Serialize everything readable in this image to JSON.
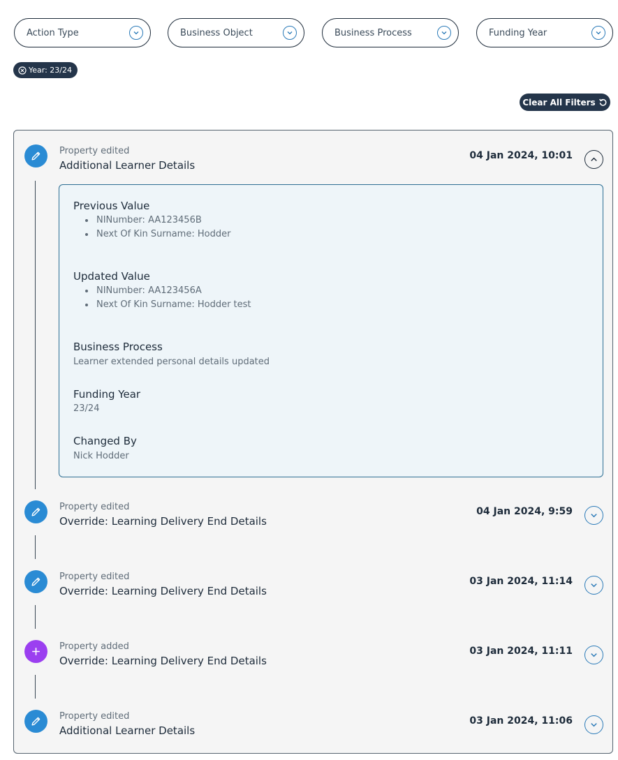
{
  "filters": [
    {
      "label": "Action Type"
    },
    {
      "label": "Business Object"
    },
    {
      "label": "Business Process"
    },
    {
      "label": "Funding Year"
    }
  ],
  "active_chip": {
    "label": "Year: 23/24",
    "icon": "close-circle-icon"
  },
  "clear_button": {
    "label": "Clear All Filters",
    "icon": "reset-icon"
  },
  "timeline": [
    {
      "action": "Property edited",
      "title": "Additional Learner Details",
      "date": "04 Jan 2024, 10:01",
      "icon": "pencil-icon",
      "expanded": true
    },
    {
      "action": "Property edited",
      "title": "Override: Learning Delivery End Details",
      "date": "04 Jan 2024, 9:59",
      "icon": "pencil-icon",
      "expanded": false
    },
    {
      "action": "Property edited",
      "title": "Override: Learning Delivery End Details",
      "date": "03 Jan 2024, 11:14",
      "icon": "pencil-icon",
      "expanded": false
    },
    {
      "action": "Property added",
      "title": "Override: Learning Delivery End Details",
      "date": "03 Jan 2024, 11:11",
      "icon": "plus-icon",
      "expanded": false
    },
    {
      "action": "Property edited",
      "title": "Additional Learner Details",
      "date": "03 Jan 2024, 11:06",
      "icon": "pencil-icon",
      "expanded": false
    }
  ],
  "details": {
    "previous_heading": "Previous Value",
    "previous_items": [
      "NINumber: AA123456B",
      "Next Of Kin Surname: Hodder"
    ],
    "updated_heading": "Updated Value",
    "updated_items": [
      "NINumber: AA123456A",
      "Next Of Kin Surname: Hodder test"
    ],
    "business_process_heading": "Business Process",
    "business_process_value": "Learner extended personal details updated",
    "funding_year_heading": "Funding Year",
    "funding_year_value": "23/24",
    "changed_by_heading": "Changed By",
    "changed_by_value": "Nick Hodder"
  },
  "colors": {
    "dark": "#24354a",
    "accent": "#2a8bd4",
    "add": "#9b3ff0",
    "panel": "#f5f5f5",
    "details_bg": "#eef5f9"
  }
}
